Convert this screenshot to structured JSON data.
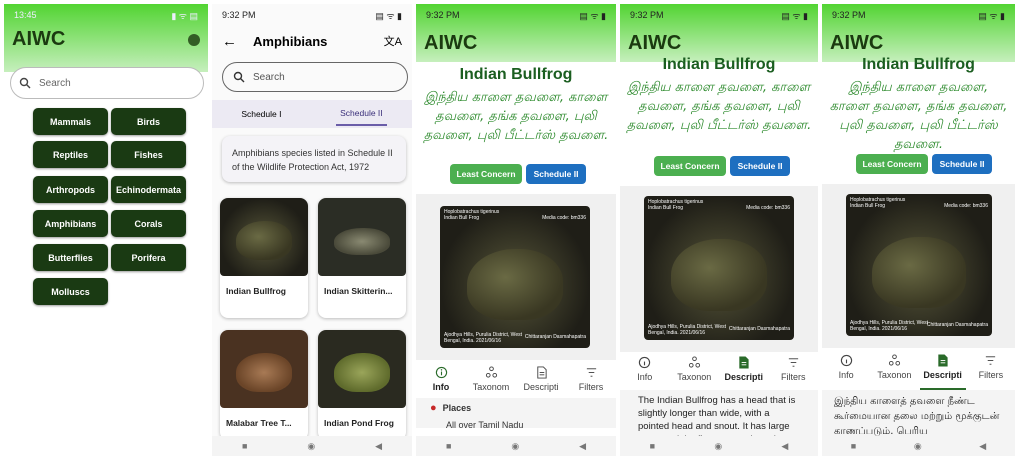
{
  "screen1": {
    "status_time": "13:45",
    "status_icons": "▮ ᯤ ▤",
    "title": "AIWC",
    "search_placeholder": "Search",
    "categories": [
      "Mammals",
      "Birds",
      "Reptiles",
      "Fishes",
      "Arthropods",
      "Echinodermata",
      "Amphibians",
      "Corals",
      "Butterflies",
      "Porifera",
      "Molluscs"
    ]
  },
  "screen2": {
    "status_time": "9:32 PM",
    "title": "Amphibians",
    "search_placeholder": "Search",
    "tabs": [
      "Schedule I",
      "Schedule II"
    ],
    "description": "Amphibians species listed in Schedule II of the Wildlife Protection Act, 1972",
    "species": [
      "Indian Bullfrog",
      "Indian Skitterin...",
      "Malabar Tree T...",
      "Indian Pond Frog"
    ]
  },
  "detail": {
    "status_time": "9:32 PM",
    "app_title": "AIWC",
    "species_name": "Indian Bullfrog",
    "tamil_name": "இந்திய காளை தவளை, காளை தவளை, தங்க தவளை, புலி தவளை, புலி பீட்டர்ஸ் தவளை.",
    "status_badge": "Least Concern",
    "schedule_badge": "Schedule II",
    "image_sci": "Hoplobatrachus tigerinus",
    "image_common": "Indian Bull Frog",
    "media_code": "Media code: bm336",
    "image_location": "Ajodhya Hills, Purulia District, West Bengal, India.",
    "image_date": "2021/06/16",
    "image_credit": "Chittaranjan Dasmahapatra",
    "tabs": [
      "Info",
      "Taxonom",
      "Descripti",
      "Filters"
    ],
    "tabs_b": [
      "Info",
      "Taxonon",
      "Descripti",
      "Filters"
    ],
    "places_label": "Places",
    "places_value": "All over Tamil Nadu",
    "desc_en": "The Indian Bullfrog has a head that is slightly longer than wide, with a pointed head and snout. It has large eyes, and the fingers are obtusely",
    "desc_ta": "இந்திய காளைத் தவளை நீண்ட கூர்மையான தலை மற்றும் மூக்குடன் காணப்படும். பெரிய"
  },
  "colors": {
    "dark_green": "#1a3a13",
    "least_concern": "#4caf50",
    "schedule": "#1e6fc0"
  }
}
